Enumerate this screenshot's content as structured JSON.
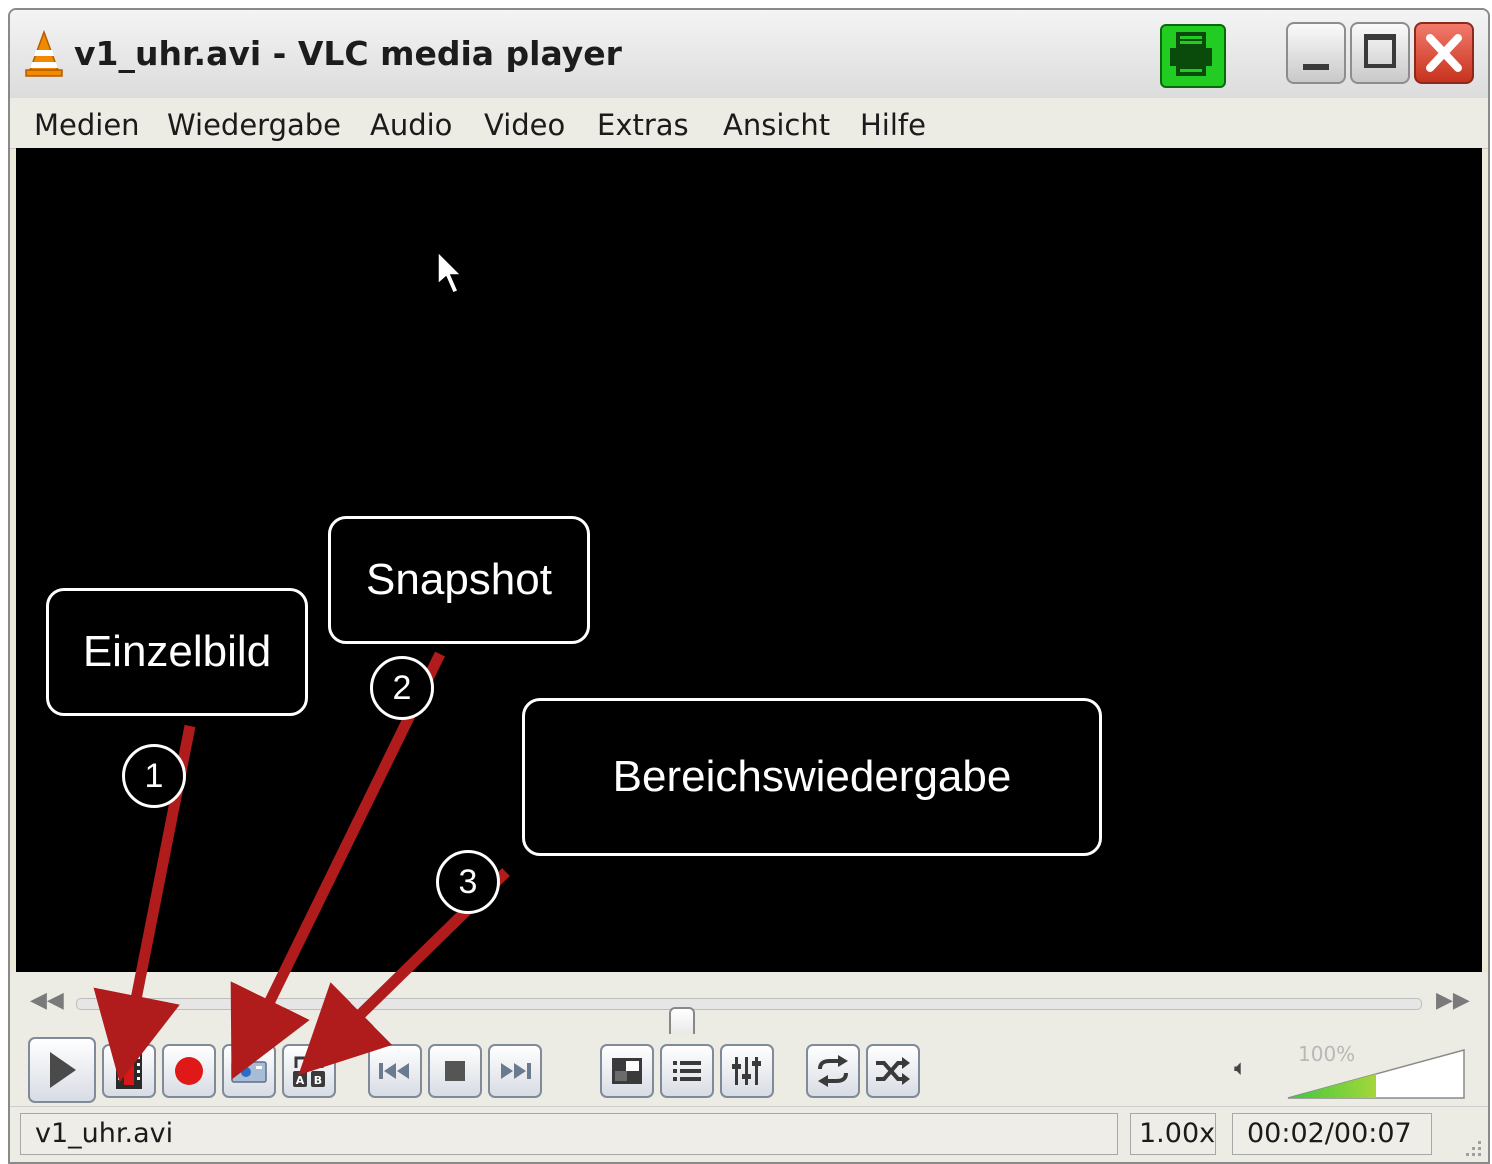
{
  "window": {
    "title": "v1_uhr.avi - VLC media player"
  },
  "menu": [
    "Medien",
    "Wiedergabe",
    "Audio",
    "Video",
    "Extras",
    "Ansicht",
    "Hilfe"
  ],
  "controls": {
    "play": "play-icon",
    "frame_by_frame": "frame-by-frame-icon",
    "record": "record-icon",
    "snapshot": "snapshot-icon",
    "ab_loop": "ab-loop-icon",
    "previous": "previous-icon",
    "stop": "stop-icon",
    "next": "next-icon",
    "fullscreen": "fullscreen-icon",
    "playlist": "playlist-icon",
    "extended_settings": "equalizer-icon",
    "loop": "loop-icon",
    "shuffle": "shuffle-icon"
  },
  "seek": {
    "position_fraction": 0.45
  },
  "volume": {
    "label": "100%",
    "level_fraction": 0.5
  },
  "status": {
    "filename": "v1_uhr.avi",
    "speed": "1.00x",
    "time": "00:02/00:07"
  },
  "annotations": {
    "einzelbild": "Einzelbild",
    "snapshot": "Snapshot",
    "bereichswiedergabe": "Bereichswiedergabe",
    "num1": "1",
    "num2": "2",
    "num3": "3"
  },
  "colors": {
    "arrow": "#b01c1c",
    "video_bg": "#000000",
    "record": "#e01818",
    "tray_icon": "#22cc22",
    "close_button": "#d5432e"
  }
}
